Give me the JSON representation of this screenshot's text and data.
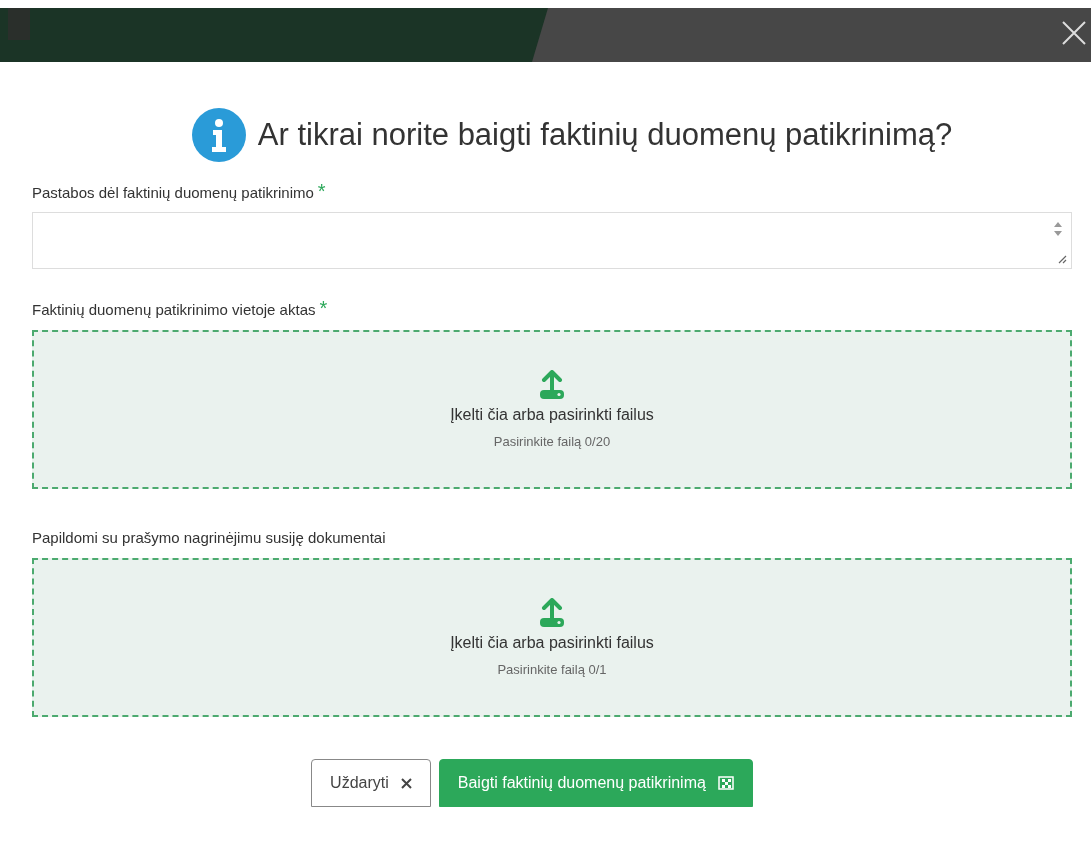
{
  "dialog": {
    "title": "Ar tikrai norite baigti faktinių duomenų patikrinimą?"
  },
  "fields": [
    {
      "kind": "textarea",
      "label": "Pastabos dėl faktinių duomenų patikrinimo",
      "required": true
    },
    {
      "kind": "upload",
      "label": "Faktinių duomenų patikrinimo vietoje aktas",
      "required": true,
      "prompt": "Įkelti čia arba pasirinkti failus",
      "hint": "Pasirinkite failą 0/20"
    },
    {
      "kind": "upload",
      "label": "Papildomi su prašymo nagrinėjimu susiję dokumentai",
      "required": false,
      "prompt": "Įkelti čia arba pasirinkti failus",
      "hint": "Pasirinkite failą 0/1"
    }
  ],
  "required_mark": "*",
  "buttons": [
    {
      "kind": "close",
      "label": "Uždaryti"
    },
    {
      "kind": "primary",
      "label": "Baigti faktinių duomenų patikrinimą"
    }
  ]
}
